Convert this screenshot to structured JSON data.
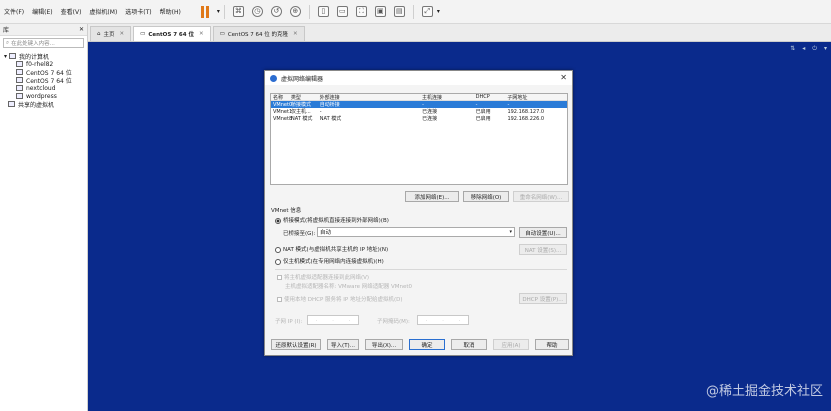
{
  "menubar": {
    "items": [
      "文件(F)",
      "编辑(E)",
      "查看(V)",
      "虚拟机(M)",
      "选项卡(T)",
      "帮助(H)"
    ]
  },
  "sidebar": {
    "header": "库",
    "search_placeholder": "在此处键入内容...",
    "tree": {
      "my_computer": "我的计算机",
      "vms": [
        "f0-rhel82",
        "CentOS 7 64 位",
        "CentOS 7 64 位",
        "nextcloud",
        "wordpress"
      ],
      "shared": "共享的虚拟机"
    }
  },
  "tabs": [
    {
      "label": "主页"
    },
    {
      "label": "CentOS 7 64 位"
    },
    {
      "label": "CentOS 7 64 位 的克隆"
    }
  ],
  "dialog": {
    "title": "虚拟网络编辑器",
    "columns": [
      "名称",
      "类型",
      "外部连接",
      "主机连接",
      "DHCP",
      "子网地址"
    ],
    "rows": [
      [
        "VMnet0",
        "桥接模式",
        "自动桥接",
        "-",
        "-",
        "-"
      ],
      [
        "VMnet1",
        "仅主机...",
        "-",
        "已连接",
        "已启用",
        "192.168.127.0"
      ],
      [
        "VMnet8",
        "NAT 模式",
        "NAT 模式",
        "已连接",
        "已启用",
        "192.168.226.0"
      ]
    ],
    "table_buttons": {
      "add": "添加网络(E)...",
      "remove": "移除网络(O)",
      "rename": "重命名网络(W)..."
    },
    "section_title": "VMnet 信息",
    "bridged_label": "桥接模式(将虚拟机直接连接到外部网络)(B)",
    "bridged_to_label": "已桥接至(G):",
    "bridged_to_value": "自动",
    "auto_settings": "自动设置(U)...",
    "nat_label": "NAT 模式(与虚拟机共享主机的 IP 地址)(N)",
    "nat_settings": "NAT 设置(S)...",
    "hostonly_label": "仅主机模式(在专用网络内连接虚拟机)(H)",
    "host_adapter_label": "将主机虚拟适配器连接到此网络(V)",
    "host_adapter_name": "主机虚拟适配器名称: VMware 网络适配器 VMnet0",
    "dhcp_label": "使用本地 DHCP 服务将 IP 地址分配给虚拟机(D)",
    "dhcp_settings": "DHCP 设置(P)...",
    "subnet_ip_label": "子网 IP (I):",
    "subnet_mask_label": "子网掩码(M):",
    "footer": {
      "restore": "还原默认设置(R)",
      "import": "导入(T)...",
      "export": "导出(X)...",
      "ok": "确定",
      "cancel": "取消",
      "apply": "应用(A)",
      "help": "帮助"
    }
  },
  "watermark": "@稀土掘金技术社区",
  "colors": {
    "desktop": "#0a2a8c",
    "selection": "#2a7bd7",
    "pause": "#e07818"
  }
}
